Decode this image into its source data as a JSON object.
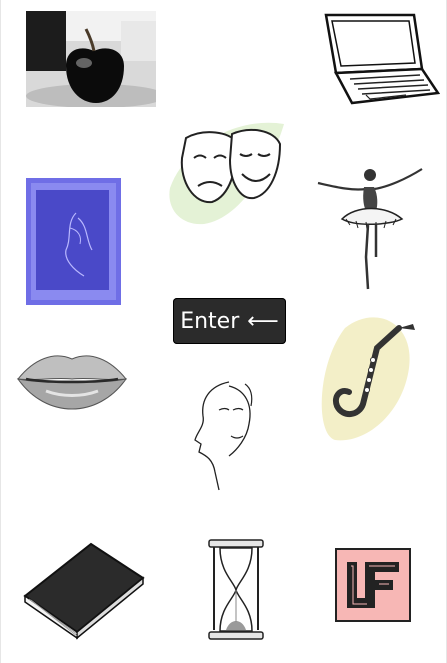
{
  "enter_key": {
    "label": "Enter",
    "icon": "return-arrow-icon",
    "glyph": "⟵"
  },
  "tiles": [
    {
      "name": "black-apple-image"
    },
    {
      "name": "laptop-sketch-image"
    },
    {
      "name": "theater-masks-image"
    },
    {
      "name": "blue-poster-image"
    },
    {
      "name": "ballerina-sketch-image"
    },
    {
      "name": "lips-sketch-image"
    },
    {
      "name": "saxophone-sketch-image"
    },
    {
      "name": "line-art-faces-image"
    },
    {
      "name": "book-image"
    },
    {
      "name": "hourglass-image"
    },
    {
      "name": "lf-monogram-logo"
    }
  ],
  "colors": {
    "enter_bg": "#2b2b2b",
    "poster_blue": "#6f6ee6",
    "masks_blob": "#e4f2d6",
    "sax_blob": "#f3efc8",
    "logo_pink": "#f7b7b5"
  }
}
